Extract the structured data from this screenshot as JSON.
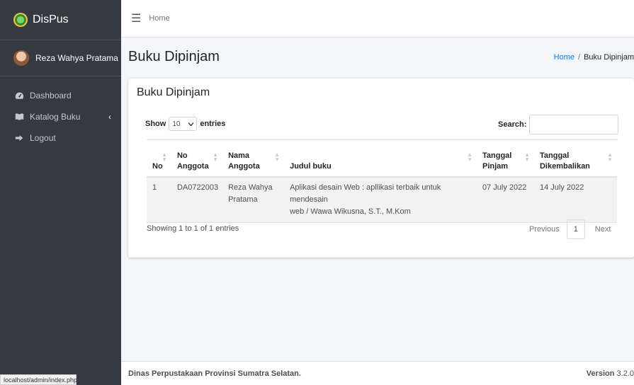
{
  "app": {
    "brand": "DisPus",
    "status_url": "localhost/admin/index.php"
  },
  "user": {
    "name": "Reza Wahya Pratama"
  },
  "sidebar": {
    "items": [
      {
        "label": "Dashboard",
        "icon": "dashboard-icon"
      },
      {
        "label": "Katalog Buku",
        "icon": "book-icon",
        "caret": "‹"
      },
      {
        "label": "Logout",
        "icon": "sign-out-icon"
      }
    ]
  },
  "topbar": {
    "home": "Home"
  },
  "header": {
    "title": "Buku Dipinjam",
    "breadcrumb": {
      "home": "Home",
      "sep": "/",
      "current": "Buku Dipinjam"
    }
  },
  "card": {
    "title": "Buku Dipinjam",
    "show_label": "Show",
    "entries_label": "entries",
    "page_size": "10",
    "search_label": "Search:",
    "search_value": ""
  },
  "table": {
    "headers": {
      "no": "No",
      "no_anggota_1": "No",
      "no_anggota_2": "Anggota",
      "nama_1": "Nama",
      "nama_2": "Anggota",
      "judul": "Judul buku",
      "pinjam_1": "Tanggal",
      "pinjam_2": "Pinjam",
      "kembali_1": "Tanggal",
      "kembali_2": "Dikembalikan"
    },
    "rows": [
      {
        "no": "1",
        "no_anggota": "DA0722003",
        "nama_1": "Reza Wahya",
        "nama_2": "Pratama",
        "judul_1": "Aplikasi desain Web : apllikasi terbaik untuk mendesain",
        "judul_2": "web / Wawa Wikusna, S.T., M.Kom",
        "tanggal_pinjam": "07 July 2022",
        "tanggal_kembali": "14 July 2022"
      }
    ]
  },
  "pagination": {
    "info": "Showing 1 to 1 of 1 entries",
    "previous": "Previous",
    "current": "1",
    "next": "Next"
  },
  "footer": {
    "text": "Dinas Perpustakaan Provinsi Sumatra Selatan.",
    "version_label": "Version",
    "version": "3.2.0"
  }
}
